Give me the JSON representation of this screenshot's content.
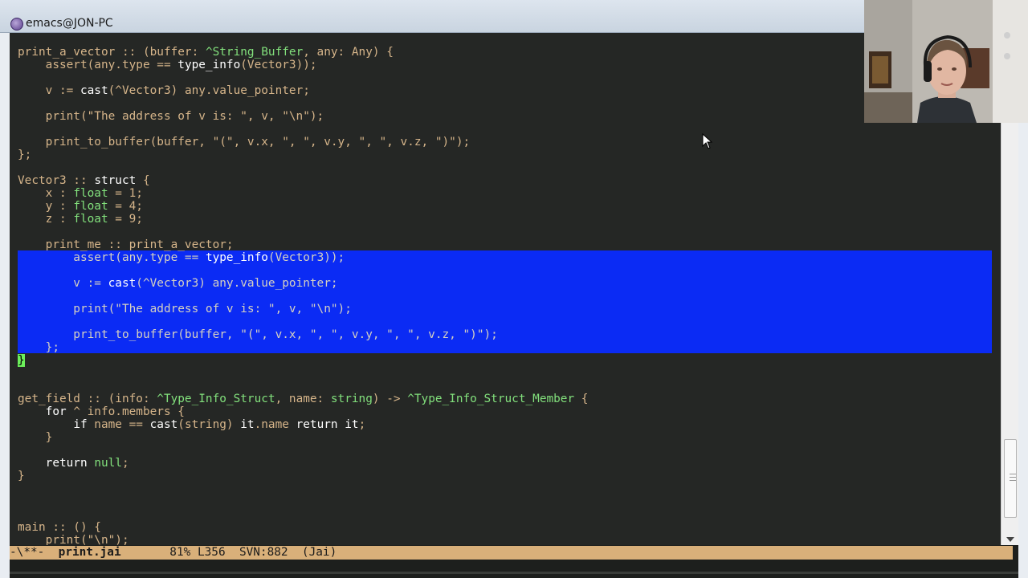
{
  "window": {
    "title": "emacs@JON-PC"
  },
  "code_lines": [
    [
      {
        "t": "print_a_vector :: (buffer: ",
        "c": "s"
      },
      {
        "t": "^String_Buffer",
        "c": "tp"
      },
      {
        "t": ", any: Any) {",
        "c": "s"
      }
    ],
    [
      {
        "t": "    assert(any.type == ",
        "c": "s"
      },
      {
        "t": "type_info",
        "c": "kw"
      },
      {
        "t": "(Vector3));",
        "c": "s"
      }
    ],
    [],
    [
      {
        "t": "    v := ",
        "c": "s"
      },
      {
        "t": "cast",
        "c": "kw"
      },
      {
        "t": "(^Vector3) any.value_pointer;",
        "c": "s"
      }
    ],
    [],
    [
      {
        "t": "    print(\"The address of v is: \", v, \"\\n\");",
        "c": "s"
      }
    ],
    [],
    [
      {
        "t": "    print_to_buffer(buffer, \"(\", v.x, \", \", v.y, \", \", v.z, \")\");",
        "c": "s"
      }
    ],
    [
      {
        "t": "};",
        "c": "s"
      }
    ],
    [],
    [
      {
        "t": "Vector3 :: ",
        "c": "s"
      },
      {
        "t": "struct",
        "c": "kw"
      },
      {
        "t": " {",
        "c": "s"
      }
    ],
    [
      {
        "t": "    x : ",
        "c": "s"
      },
      {
        "t": "float",
        "c": "tp"
      },
      {
        "t": " = 1;",
        "c": "s"
      }
    ],
    [
      {
        "t": "    y : ",
        "c": "s"
      },
      {
        "t": "float",
        "c": "tp"
      },
      {
        "t": " = 4;",
        "c": "s"
      }
    ],
    [
      {
        "t": "    z : ",
        "c": "s"
      },
      {
        "t": "float",
        "c": "tp"
      },
      {
        "t": " = 9;",
        "c": "s"
      }
    ],
    [],
    [
      {
        "t": "    print_me :: print_a_vector;",
        "c": "s"
      }
    ],
    [
      {
        "t": "        assert(any.type == ",
        "c": "s"
      },
      {
        "t": "type_info",
        "c": "kw"
      },
      {
        "t": "(Vector3));",
        "c": "s"
      }
    ],
    [],
    [
      {
        "t": "        v := ",
        "c": "s"
      },
      {
        "t": "cast",
        "c": "kw"
      },
      {
        "t": "(^Vector3) any.value_pointer;",
        "c": "s"
      }
    ],
    [],
    [
      {
        "t": "        print(\"The address of v is: \", v, \"\\n\");",
        "c": "s"
      }
    ],
    [],
    [
      {
        "t": "        print_to_buffer(buffer, \"(\", v.x, \", \", v.y, \", \", v.z, \")\");",
        "c": "s"
      }
    ],
    [
      {
        "t": "    };",
        "c": "s"
      }
    ],
    [
      {
        "t": "}",
        "c": "cursor"
      }
    ],
    [],
    [],
    [
      {
        "t": "get_field :: (info: ",
        "c": "s"
      },
      {
        "t": "^Type_Info_Struct",
        "c": "tp"
      },
      {
        "t": ", name: ",
        "c": "s"
      },
      {
        "t": "string",
        "c": "tp"
      },
      {
        "t": ") -> ",
        "c": "s"
      },
      {
        "t": "^Type_Info_Struct_Member",
        "c": "tp"
      },
      {
        "t": " {",
        "c": "s"
      }
    ],
    [
      {
        "t": "    ",
        "c": "s"
      },
      {
        "t": "for",
        "c": "kw"
      },
      {
        "t": " ^ info.members {",
        "c": "s"
      }
    ],
    [
      {
        "t": "        ",
        "c": "s"
      },
      {
        "t": "if",
        "c": "kw"
      },
      {
        "t": " name == ",
        "c": "s"
      },
      {
        "t": "cast",
        "c": "kw"
      },
      {
        "t": "(string) ",
        "c": "s"
      },
      {
        "t": "it",
        "c": "kw"
      },
      {
        "t": ".name ",
        "c": "s"
      },
      {
        "t": "return",
        "c": "kw"
      },
      {
        "t": " ",
        "c": "s"
      },
      {
        "t": "it",
        "c": "kw"
      },
      {
        "t": ";",
        "c": "s"
      }
    ],
    [
      {
        "t": "    }",
        "c": "s"
      }
    ],
    [],
    [
      {
        "t": "    ",
        "c": "s"
      },
      {
        "t": "return",
        "c": "kw"
      },
      {
        "t": " ",
        "c": "s"
      },
      {
        "t": "null",
        "c": "tp"
      },
      {
        "t": ";",
        "c": "s"
      }
    ],
    [
      {
        "t": "}",
        "c": "s"
      }
    ],
    [],
    [],
    [],
    [
      {
        "t": "main :: () {",
        "c": "s"
      }
    ],
    [
      {
        "t": "    print(\"\\n\");",
        "c": "s"
      }
    ]
  ],
  "modeline": {
    "status": "-\\**-",
    "buffer_name": "print.jai",
    "position": "81% L356",
    "vcs": "SVN:882",
    "mode": "(Jai)"
  },
  "colors": {
    "background": "#252725",
    "foreground": "#d6b58a",
    "keyword": "#ffffff",
    "type": "#82e07c",
    "region": "#0b2bf4",
    "cursor": "#6cf05b",
    "modeline": "#d9b07a"
  },
  "icons": {
    "app": "emacs-icon",
    "pointer": "mouse-pointer-icon"
  }
}
